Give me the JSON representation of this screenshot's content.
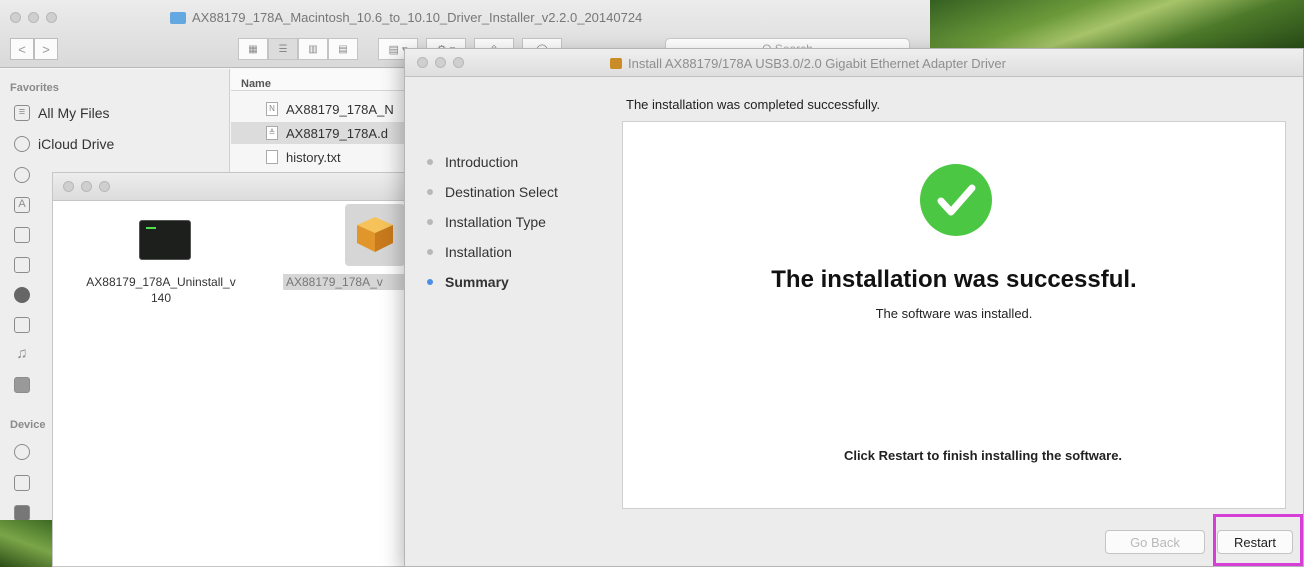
{
  "finder": {
    "title": "AX88179_178A_Macintosh_10.6_to_10.10_Driver_Installer_v2.2.0_20140724",
    "search_placeholder": "Q Search",
    "nav": {
      "back": "<",
      "forward": ">"
    },
    "favorites_header": "Favorites",
    "sidebar_items": [
      {
        "label": "All My Files",
        "icon": "all-files-icon"
      },
      {
        "label": "iCloud Drive",
        "icon": "cloud-icon"
      }
    ],
    "devices_header": "Device",
    "list_header": "Name",
    "files": [
      {
        "name": "AX88179_178A_N"
      },
      {
        "name": "AX88179_178A.d"
      },
      {
        "name": "history.txt"
      }
    ]
  },
  "win2": {
    "items": [
      {
        "label": "AX88179_178A_Uninstall_v\n140"
      },
      {
        "label": "AX88179_178A_v"
      }
    ]
  },
  "installer": {
    "title": "Install AX88179/178A USB3.0/2.0 Gigabit Ethernet Adapter Driver",
    "completed_message": "The installation was completed successfully.",
    "steps": [
      {
        "label": "Introduction"
      },
      {
        "label": "Destination Select"
      },
      {
        "label": "Installation Type"
      },
      {
        "label": "Installation"
      },
      {
        "label": "Summary"
      }
    ],
    "success_title": "The installation was successful.",
    "success_subtitle": "The software was installed.",
    "restart_instruction": "Click Restart to finish installing the software.",
    "go_back_label": "Go Back",
    "restart_label": "Restart",
    "highlight_color": "#d63fd6",
    "success_color": "#4cc744"
  }
}
